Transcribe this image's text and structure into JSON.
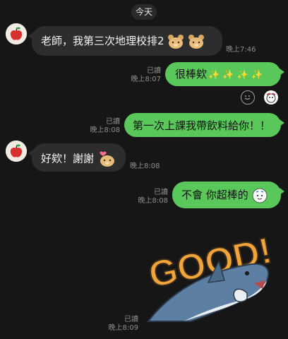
{
  "date_divider": "今天",
  "messages": [
    {
      "id": "m1",
      "direction": "in",
      "text": "老師，我第三次地理校排2",
      "time": "晚上7:46"
    },
    {
      "id": "m2",
      "direction": "out",
      "text": "很棒欸",
      "read": "已讀",
      "time": "晚上8:07"
    },
    {
      "id": "m3",
      "direction": "out",
      "text": "第一次上課我帶飲料給你！！",
      "read": "已讀",
      "time": "晚上8:08"
    },
    {
      "id": "m4",
      "direction": "in",
      "text": "好欸！謝謝",
      "time": "晚上8:08"
    },
    {
      "id": "m5",
      "direction": "out",
      "text": "不會 你超棒的",
      "read": "已讀",
      "time": "晚上8:08"
    },
    {
      "id": "m6",
      "direction": "out",
      "sticker": "GOOD!",
      "read": "已讀",
      "time": "晚上8:09"
    }
  ],
  "colors": {
    "background": "#161616",
    "incoming_bubble": "#2d2d2d",
    "outgoing_bubble": "#5ac75a",
    "meta_text": "#8e8e8e"
  },
  "icons": [
    "apple-avatar-icon",
    "bear-emoji-icon",
    "sparkle-emoji-icon",
    "smile-reaction-icon",
    "sticker-reaction-icon",
    "shark-sticker"
  ]
}
